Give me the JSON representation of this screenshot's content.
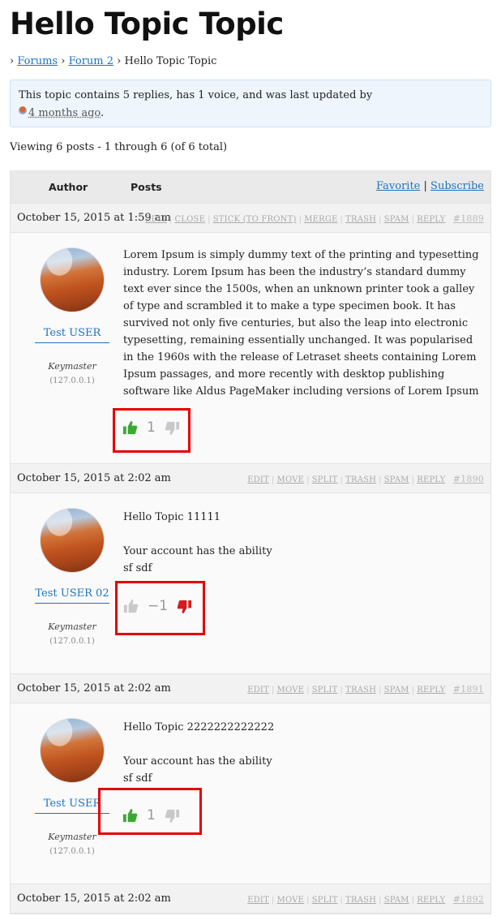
{
  "title": "Hello Topic Topic",
  "breadcrumb": {
    "sep": "›",
    "forums": "Forums",
    "forum2": "Forum 2",
    "current": "Hello Topic Topic"
  },
  "notice": {
    "text": "This topic contains 5 replies, has 1 voice, and was last updated by",
    "freshness": "4 months ago",
    "period": "."
  },
  "pagination": "Viewing 6 posts - 1 through 6 (of 6 total)",
  "header": {
    "author": "Author",
    "posts": "Posts",
    "favorite": "Favorite",
    "separator": "|",
    "subscribe": "Subscribe"
  },
  "colors": {
    "link": "#1e73be",
    "upvote": "#3aa832",
    "downvote": "#d31c1c",
    "inactive": "#c9c9c9",
    "highlight": "#e60000"
  },
  "posts": [
    {
      "date": "October 15, 2015 at 1:59 am",
      "admin": [
        "EDIT",
        "CLOSE",
        "STICK (TO FRONT)",
        "MERGE",
        "TRASH",
        "SPAM",
        "REPLY"
      ],
      "id": "#1889",
      "author": "Test USER",
      "role": "Keymaster",
      "ip": "(127.0.0.1)",
      "content": [
        "Lorem Ipsum is simply dummy text of the printing and typesetting industry. Lorem Ipsum has been the industry’s standard dummy text ever since the 1500s, when an unknown printer took a galley of type and scrambled it to make a type specimen book. It has survived not only five centuries, but also the leap into electronic typesetting, remaining essentially unchanged. It was popularised in the 1960s with the release of Letraset sheets containing Lorem Ipsum passages, and more recently with desktop publishing software like Aldus PageMaker including versions of Lorem Ipsum"
      ],
      "vote_count": "1",
      "up_icon": "thumbs-up-icon",
      "down_icon": "thumbs-down-icon",
      "voted": "up"
    },
    {
      "date": "October 15, 2015 at 2:02 am",
      "admin": [
        "EDIT",
        "MOVE",
        "SPLIT",
        "TRASH",
        "SPAM",
        "REPLY"
      ],
      "id": "#1890",
      "author": "Test USER 02",
      "role": "Keymaster",
      "ip": "(127.0.0.1)",
      "content": [
        "Hello Topic 11111",
        "Your account has the ability",
        "sf sdf"
      ],
      "vote_count": "−1",
      "up_icon": "thumbs-up-icon",
      "down_icon": "thumbs-down-icon",
      "voted": "down"
    },
    {
      "date": "October 15, 2015 at 2:02 am",
      "admin": [
        "EDIT",
        "MOVE",
        "SPLIT",
        "TRASH",
        "SPAM",
        "REPLY"
      ],
      "id": "#1891",
      "author": "Test USER",
      "role": "Keymaster",
      "ip": "(127.0.0.1)",
      "content": [
        "Hello Topic 2222222222222",
        "Your account has the ability",
        "sf sdf"
      ],
      "vote_count": "1",
      "up_icon": "thumbs-up-icon",
      "down_icon": "thumbs-down-icon",
      "voted": "up"
    },
    {
      "date": "October 15, 2015 at 2:02 am",
      "admin": [
        "EDIT",
        "MOVE",
        "SPLIT",
        "TRASH",
        "SPAM",
        "REPLY"
      ],
      "id": "#1892"
    }
  ]
}
